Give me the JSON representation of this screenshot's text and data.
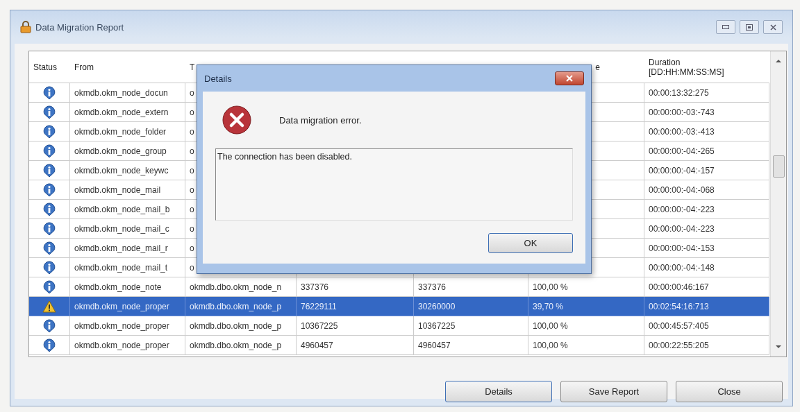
{
  "window": {
    "title": "Data Migration Report"
  },
  "table": {
    "columns": [
      "Status",
      "From",
      "T",
      null,
      null,
      "e",
      "Duration\n[DD:HH:MM:SS:MS]"
    ],
    "rows": [
      {
        "kind": "info",
        "selected": false,
        "cells": [
          null,
          "okmdb.okm_node_docun",
          "o",
          null,
          null,
          null,
          "00:00:13:32:275"
        ]
      },
      {
        "kind": "info",
        "selected": false,
        "cells": [
          null,
          "okmdb.okm_node_extern",
          "o",
          null,
          null,
          null,
          "00:00:00:-03:-743"
        ]
      },
      {
        "kind": "info",
        "selected": false,
        "cells": [
          null,
          "okmdb.okm_node_folder",
          "o",
          null,
          null,
          null,
          "00:00:00:-03:-413"
        ]
      },
      {
        "kind": "info",
        "selected": false,
        "cells": [
          null,
          "okmdb.okm_node_group",
          "o",
          null,
          null,
          null,
          "00:00:00:-04:-265"
        ]
      },
      {
        "kind": "info",
        "selected": false,
        "cells": [
          null,
          "okmdb.okm_node_keywc",
          "o",
          null,
          null,
          null,
          "00:00:00:-04:-157"
        ]
      },
      {
        "kind": "info",
        "selected": false,
        "cells": [
          null,
          "okmdb.okm_node_mail",
          "o",
          null,
          null,
          null,
          "00:00:00:-04:-068"
        ]
      },
      {
        "kind": "info",
        "selected": false,
        "cells": [
          null,
          "okmdb.okm_node_mail_b",
          "o",
          null,
          null,
          null,
          "00:00:00:-04:-223"
        ]
      },
      {
        "kind": "info",
        "selected": false,
        "cells": [
          null,
          "okmdb.okm_node_mail_c",
          "o",
          null,
          null,
          null,
          "00:00:00:-04:-223"
        ]
      },
      {
        "kind": "info",
        "selected": false,
        "cells": [
          null,
          "okmdb.okm_node_mail_r",
          "o",
          null,
          null,
          null,
          "00:00:00:-04:-153"
        ]
      },
      {
        "kind": "info",
        "selected": false,
        "cells": [
          null,
          "okmdb.okm_node_mail_t",
          "o",
          null,
          null,
          null,
          "00:00:00:-04:-148"
        ]
      },
      {
        "kind": "info",
        "selected": false,
        "cells": [
          null,
          "okmdb.okm_node_note",
          "okmdb.dbo.okm_node_n",
          "337376",
          "337376",
          "100,00 %",
          "00:00:00:46:167"
        ]
      },
      {
        "kind": "warning",
        "selected": true,
        "cells": [
          null,
          "okmdb.okm_node_proper",
          "okmdb.dbo.okm_node_p",
          "76229111",
          "30260000",
          "39,70 %",
          "00:02:54:16:713"
        ]
      },
      {
        "kind": "info",
        "selected": false,
        "cells": [
          null,
          "okmdb.okm_node_proper",
          "okmdb.dbo.okm_node_p",
          "10367225",
          "10367225",
          "100,00 %",
          "00:00:45:57:405"
        ]
      },
      {
        "kind": "info",
        "selected": false,
        "cells": [
          null,
          "okmdb.okm_node_proper",
          "okmdb.dbo.okm_node_p",
          "4960457",
          "4960457",
          "100,00 %",
          "00:00:22:55:205"
        ]
      }
    ]
  },
  "buttons": [
    "Details",
    "Save Report",
    "Close"
  ],
  "dialog": {
    "title": "Details",
    "message": "Data migration error.",
    "detail": "The connection has been disabled.",
    "button": "OK"
  }
}
